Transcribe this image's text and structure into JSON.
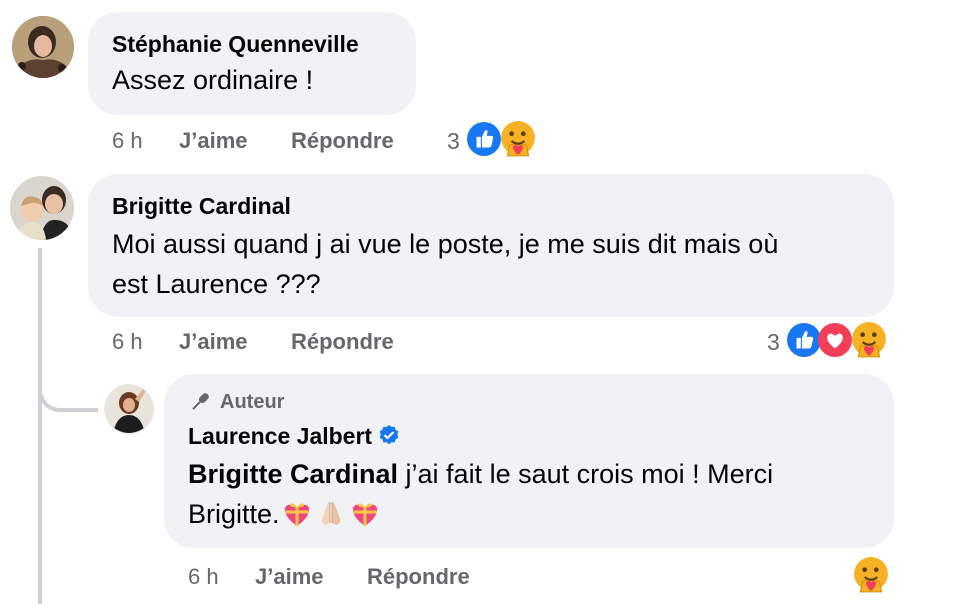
{
  "comments": [
    {
      "author": "Stéphanie Quenneville",
      "text": "Assez ordinaire !",
      "time": "6 h",
      "like_label": "J’aime",
      "reply_label": "Répondre",
      "reaction_count": "3",
      "reactions": [
        "like",
        "care"
      ]
    },
    {
      "author": "Brigitte Cardinal",
      "text_line1": "Moi aussi quand j ai vue le poste, je me suis dit mais où",
      "text_line2": "est Laurence ???",
      "time": "6 h",
      "like_label": "J’aime",
      "reply_label": "Répondre",
      "reaction_count": "3",
      "reactions": [
        "like",
        "love",
        "care"
      ]
    }
  ],
  "reply": {
    "badge": "Auteur",
    "author": "Laurence Jalbert",
    "mention": "Brigitte Cardinal",
    "text_line1": " j’ai fait le saut crois moi ! Merci",
    "text_line2": "Brigitte.",
    "emojis": [
      "heart-with-ribbon",
      "folded-hands",
      "heart-with-ribbon"
    ],
    "time": "6 h",
    "like_label": "J’aime",
    "reply_label": "Répondre",
    "reactions": [
      "care"
    ]
  },
  "colors": {
    "bubble": "#f0f2f5",
    "meta_text": "#65676b",
    "like_blue": "#1877f2",
    "love_red": "#f33e58",
    "care_yellow": "#f7b125",
    "verified_blue": "#1877f2"
  }
}
